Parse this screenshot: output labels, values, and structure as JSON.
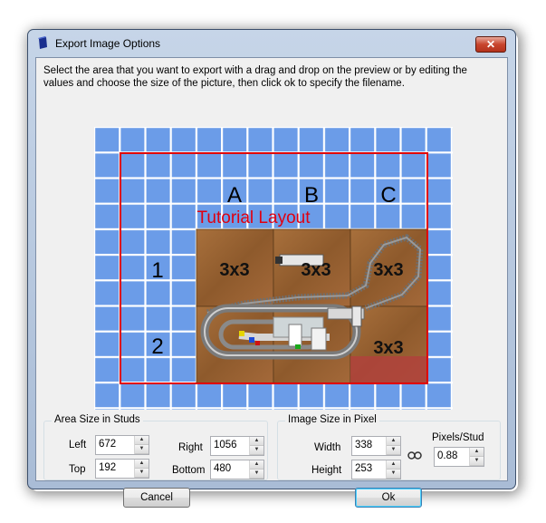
{
  "window": {
    "title": "Export Image Options",
    "close_glyph": "✕"
  },
  "instructions": "Select the area that you want to export with a drag and drop on the preview or by editing the values and choose the size of the picture, then click ok to specify the filename.",
  "preview": {
    "layout_title": "Tutorial Layout",
    "column_labels": [
      "A",
      "B",
      "C"
    ],
    "row_labels": [
      "1",
      "2"
    ],
    "plate_labels": [
      "3x3",
      "3x3",
      "3x3",
      "3x3"
    ],
    "grid_color": "#6a9ae8",
    "selection_color": "#e00000"
  },
  "area_size": {
    "legend": "Area Size in Studs",
    "left_label": "Left",
    "left_value": "672",
    "top_label": "Top",
    "top_value": "192",
    "right_label": "Right",
    "right_value": "1056",
    "bottom_label": "Bottom",
    "bottom_value": "480"
  },
  "image_size": {
    "legend": "Image Size in Pixel",
    "width_label": "Width",
    "width_value": "338",
    "height_label": "Height",
    "height_value": "253",
    "pixels_per_stud_label": "Pixels/Stud",
    "pixels_per_stud_value": "0.88",
    "link_icon": "chain-link-icon"
  },
  "buttons": {
    "cancel": "Cancel",
    "ok": "Ok"
  }
}
